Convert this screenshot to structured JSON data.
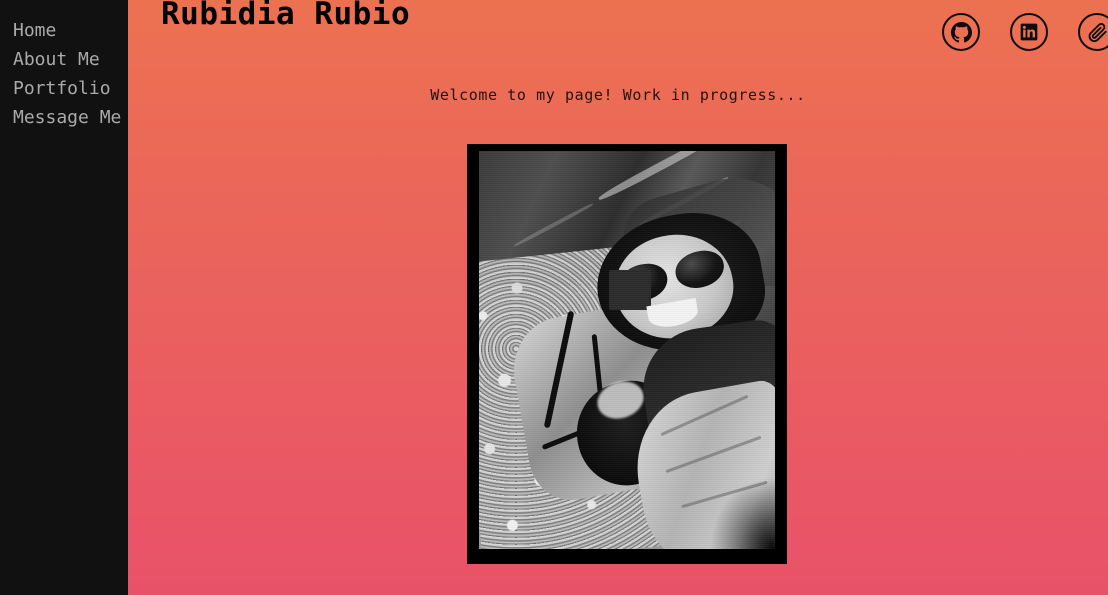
{
  "sidebar": {
    "items": [
      {
        "label": "Home",
        "name": "sidebar-item-home"
      },
      {
        "label": "About Me",
        "name": "sidebar-item-about-me"
      },
      {
        "label": "Portfolio",
        "name": "sidebar-item-portfolio"
      },
      {
        "label": "Message Me",
        "name": "sidebar-item-message-me"
      }
    ]
  },
  "header": {
    "title": "Rubidia Rubio",
    "social": [
      {
        "icon": "github-icon",
        "label": "GitHub"
      },
      {
        "icon": "linkedin-icon",
        "label": "LinkedIn"
      },
      {
        "icon": "paperclip-icon",
        "label": "Resume"
      }
    ]
  },
  "main": {
    "welcome_text": "Welcome to my page! Work in progress...",
    "photo_alt": "Black and white selfie of a woman in sunglasses hiking with a child in a backpack carrier"
  },
  "colors": {
    "sidebar_bg": "#111111",
    "nav_text": "#aaaaaa",
    "gradient_top": "#ec7151",
    "gradient_bottom": "#e85269",
    "title_text": "#000000",
    "welcome_text": "#241311",
    "frame_border": "#000000",
    "frame_mat": "#000000"
  }
}
